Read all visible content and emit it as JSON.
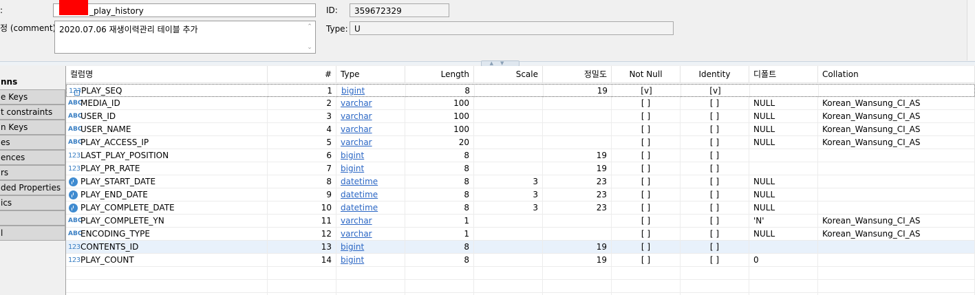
{
  "props": {
    "name_label": ":",
    "name_value": "_play_history",
    "comment_label": "정 (comment):",
    "comment_value": "2020.07.06 재생이력관리 테이블 추가",
    "id_label": "ID:",
    "id_value": "359672329",
    "type_label": "Type:",
    "type_value": "U"
  },
  "nav": {
    "items": [
      {
        "label": "nns",
        "active": true
      },
      {
        "label": "e Keys"
      },
      {
        "label": "t constraints"
      },
      {
        "label": "n Keys"
      },
      {
        "label": "es"
      },
      {
        "label": "ences"
      },
      {
        "label": "rs"
      },
      {
        "label": "ded Properties"
      },
      {
        "label": "ics"
      },
      {
        "label": ""
      },
      {
        "label": "l"
      }
    ]
  },
  "columns": {
    "headers": [
      "컬럼명",
      "#",
      "Type",
      "Length",
      "Scale",
      "정밀도",
      "Not Null",
      "Identity",
      "디폴트",
      "Collation"
    ],
    "rows": [
      {
        "icon": "123",
        "name": "PLAY_SEQ",
        "num": "1",
        "type": "bigint",
        "length": "8",
        "scale": "",
        "precision": "19",
        "notnull": "[v]",
        "identity": "[v]",
        "default": "",
        "collation": "",
        "key": true,
        "focus": true
      },
      {
        "icon": "ABC",
        "name": "MEDIA_ID",
        "num": "2",
        "type": "varchar",
        "length": "100",
        "scale": "",
        "precision": "",
        "notnull": "[ ]",
        "identity": "[ ]",
        "default": "NULL",
        "collation": "Korean_Wansung_CI_AS"
      },
      {
        "icon": "ABC",
        "name": "USER_ID",
        "num": "3",
        "type": "varchar",
        "length": "100",
        "scale": "",
        "precision": "",
        "notnull": "[ ]",
        "identity": "[ ]",
        "default": "NULL",
        "collation": "Korean_Wansung_CI_AS"
      },
      {
        "icon": "ABC",
        "name": "USER_NAME",
        "num": "4",
        "type": "varchar",
        "length": "100",
        "scale": "",
        "precision": "",
        "notnull": "[ ]",
        "identity": "[ ]",
        "default": "NULL",
        "collation": "Korean_Wansung_CI_AS"
      },
      {
        "icon": "ABC",
        "name": "PLAY_ACCESS_IP",
        "num": "5",
        "type": "varchar",
        "length": "20",
        "scale": "",
        "precision": "",
        "notnull": "[ ]",
        "identity": "[ ]",
        "default": "NULL",
        "collation": "Korean_Wansung_CI_AS"
      },
      {
        "icon": "123",
        "name": "LAST_PLAY_POSITION",
        "num": "6",
        "type": "bigint",
        "length": "8",
        "scale": "",
        "precision": "19",
        "notnull": "[ ]",
        "identity": "[ ]",
        "default": "",
        "collation": ""
      },
      {
        "icon": "123",
        "name": "PLAY_PR_RATE",
        "num": "7",
        "type": "bigint",
        "length": "8",
        "scale": "",
        "precision": "19",
        "notnull": "[ ]",
        "identity": "[ ]",
        "default": "",
        "collation": ""
      },
      {
        "icon": "clock",
        "name": "PLAY_START_DATE",
        "num": "8",
        "type": "datetime",
        "length": "8",
        "scale": "3",
        "precision": "23",
        "notnull": "[ ]",
        "identity": "[ ]",
        "default": "NULL",
        "collation": ""
      },
      {
        "icon": "clock",
        "name": "PLAY_END_DATE",
        "num": "9",
        "type": "datetime",
        "length": "8",
        "scale": "3",
        "precision": "23",
        "notnull": "[ ]",
        "identity": "[ ]",
        "default": "NULL",
        "collation": ""
      },
      {
        "icon": "clock",
        "name": "PLAY_COMPLETE_DATE",
        "num": "10",
        "type": "datetime",
        "length": "8",
        "scale": "3",
        "precision": "23",
        "notnull": "[ ]",
        "identity": "[ ]",
        "default": "NULL",
        "collation": ""
      },
      {
        "icon": "ABC",
        "name": "PLAY_COMPLETE_YN",
        "num": "11",
        "type": "varchar",
        "length": "1",
        "scale": "",
        "precision": "",
        "notnull": "[ ]",
        "identity": "[ ]",
        "default": "'N'",
        "collation": "Korean_Wansung_CI_AS"
      },
      {
        "icon": "ABC",
        "name": "ENCODING_TYPE",
        "num": "12",
        "type": "varchar",
        "length": "1",
        "scale": "",
        "precision": "",
        "notnull": "[ ]",
        "identity": "[ ]",
        "default": "NULL",
        "collation": "Korean_Wansung_CI_AS"
      },
      {
        "icon": "123",
        "name": "CONTENTS_ID",
        "num": "13",
        "type": "bigint",
        "length": "8",
        "scale": "",
        "precision": "19",
        "notnull": "[ ]",
        "identity": "[ ]",
        "default": "",
        "collation": "",
        "selected": true
      },
      {
        "icon": "123",
        "name": "PLAY_COUNT",
        "num": "14",
        "type": "bigint",
        "length": "8",
        "scale": "",
        "precision": "19",
        "notnull": "[ ]",
        "identity": "[ ]",
        "default": "0",
        "collation": ""
      }
    ]
  },
  "colors": {
    "link": "#2a66c4",
    "icon": "#3a7fc3",
    "selected_row": "#e8f1fb",
    "redaction": "#ff0000"
  }
}
